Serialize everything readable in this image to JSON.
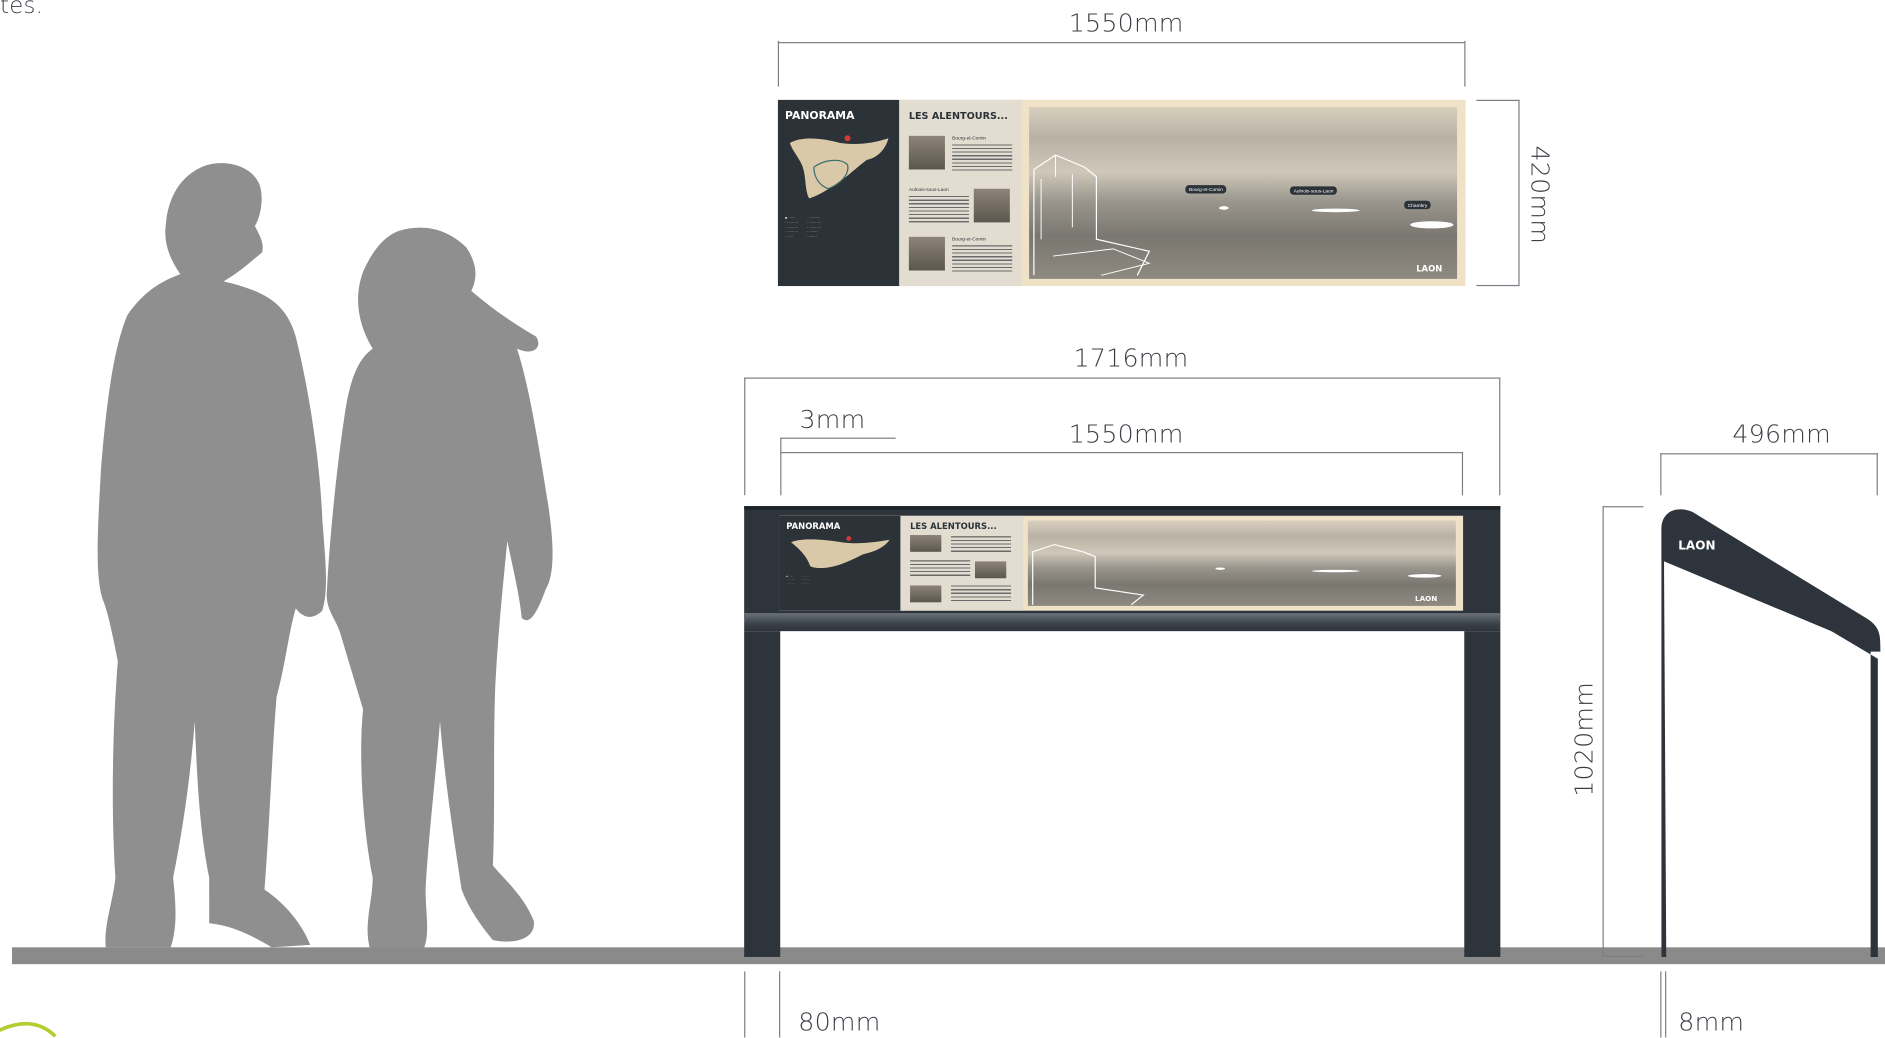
{
  "caption_fragment": "tes.",
  "dimensions": {
    "top_width": "1550mm",
    "top_height": "420mm",
    "total_width": "1716mm",
    "edge_gap": "3mm",
    "panel_width": "1550mm",
    "side_depth": "496mm",
    "height": "1020mm",
    "post_width": "80mm",
    "side_thickness": "8mm"
  },
  "panel": {
    "title_left": "PANORAMA",
    "title_mid": "LES ALENTOURS...",
    "places": [
      "Bourg-et-Comin",
      "Aulnois-sous-Laon",
      "Bourg-et-Comin"
    ],
    "tags": [
      "Bourg-et-Comin",
      "Aulnois-sous-Laon",
      "Chambry"
    ],
    "logo": "LAON"
  },
  "side_logo": "LAON",
  "colors": {
    "structure": "#2d343b",
    "ground": "#8a8a8a",
    "silhouette": "#8f8f8f",
    "panel_sepia": "#efe2c7"
  }
}
